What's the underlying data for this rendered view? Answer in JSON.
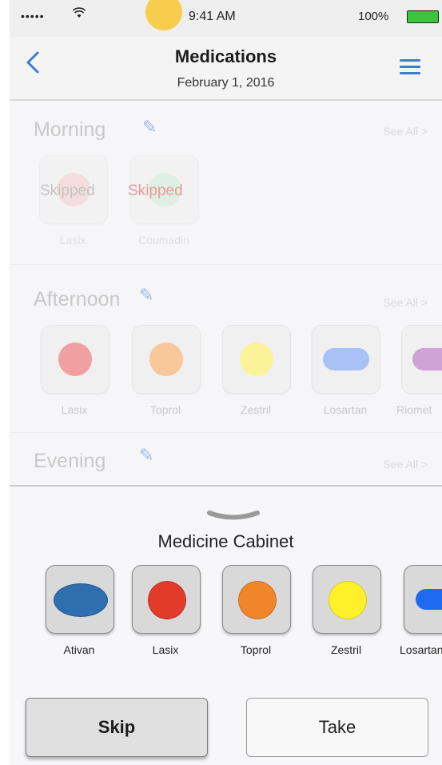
{
  "status_bar": {
    "signal": "•••••",
    "time": "9:41 AM",
    "battery": "100%"
  },
  "nav": {
    "title": "Medications",
    "date": "February 1, 2016",
    "back_glyph": "<"
  },
  "schedule": {
    "morning": {
      "title": "Morning",
      "see_all": "See All >",
      "meds": [
        {
          "name": "Lasix",
          "status": "Skipped",
          "color": "#f4b6b6"
        },
        {
          "name": "Coumadin",
          "status": "Skipped",
          "color": "#b9e6c6"
        }
      ]
    },
    "afternoon": {
      "title": "Afternoon",
      "see_all": "See All >",
      "meds": [
        {
          "name": "Lasix",
          "color": "#f0a0a0",
          "shape": "dot"
        },
        {
          "name": "Toprol",
          "color": "#f8c79a",
          "shape": "dot"
        },
        {
          "name": "Zestril",
          "color": "#fbf29a",
          "shape": "dot"
        },
        {
          "name": "Losartan",
          "color": "#a8c2f7",
          "shape": "oval"
        },
        {
          "name": "Riomet",
          "color": "#cfa3d6",
          "shape": "oval"
        }
      ]
    },
    "evening": {
      "title": "Evening",
      "see_all": "See All >"
    }
  },
  "cabinet": {
    "title": "Medicine Cabinet",
    "meds": [
      {
        "name": "Ativan",
        "color": "#2f6faf",
        "shape": "oval"
      },
      {
        "name": "Lasix",
        "color": "#e23b2a",
        "shape": "dot"
      },
      {
        "name": "Toprol",
        "color": "#f0852a",
        "shape": "dot"
      },
      {
        "name": "Zestril",
        "color": "#fff02a",
        "shape": "dot"
      },
      {
        "name": "Losartan",
        "color": "#1f6bef",
        "shape": "oval"
      }
    ]
  },
  "actions": {
    "skip_label": "Skip",
    "take_label": "Take"
  }
}
